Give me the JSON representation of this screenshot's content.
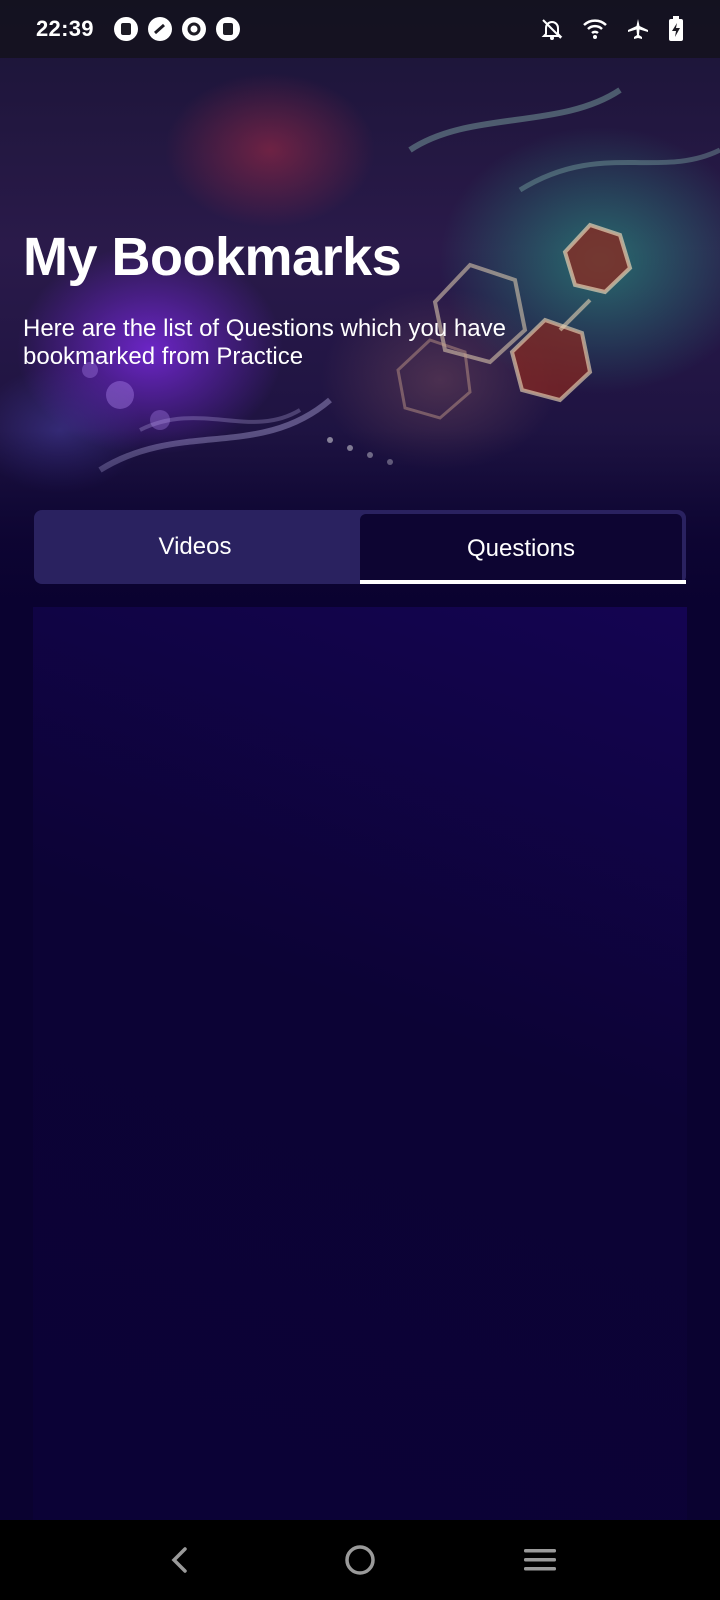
{
  "status_bar": {
    "time": "22:39",
    "left_icons": [
      "app-notification-icon",
      "speedometer-icon",
      "sync-icon",
      "app-notification-icon"
    ],
    "right_icons": [
      "bell-off-icon",
      "wifi-icon",
      "airplane-icon",
      "battery-charging-icon"
    ]
  },
  "header": {
    "title": "My Bookmarks",
    "subtitle": "Here are the list of Questions which you have bookmarked from Practice"
  },
  "tabs": [
    {
      "label": "Videos",
      "active": false
    },
    {
      "label": "Questions",
      "active": true
    }
  ],
  "nav_bar": {
    "buttons": [
      "back-icon",
      "home-icon",
      "menu-icon"
    ]
  },
  "colors": {
    "background": "#0a0230",
    "tab_bar": "#2a2260",
    "active_tab": "#0d0532",
    "text": "#ffffff"
  }
}
